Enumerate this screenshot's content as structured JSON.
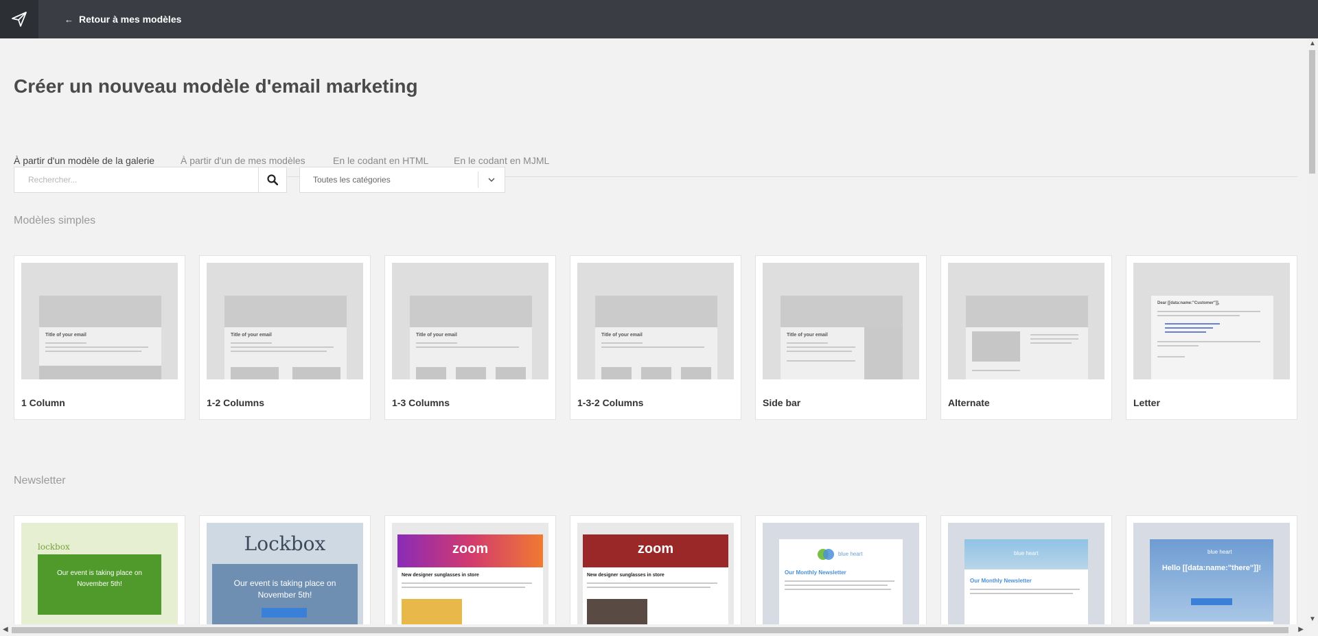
{
  "header": {
    "back_label": "Retour à mes modèles"
  },
  "page": {
    "title": "Créer un nouveau modèle d'email marketing"
  },
  "tabs": [
    {
      "label": "À partir d'un modèle de la galerie",
      "active": true
    },
    {
      "label": "À partir d'un de mes modèles",
      "active": false
    },
    {
      "label": "En le codant en HTML",
      "active": false
    },
    {
      "label": "En le codant en MJML",
      "active": false
    }
  ],
  "search": {
    "placeholder": "Rechercher..."
  },
  "category_filter": {
    "value": "Toutes les catégories"
  },
  "sections": {
    "simple": {
      "title": "Modèles simples",
      "templates": [
        {
          "label": "1 Column",
          "preview_title": "Title of your email"
        },
        {
          "label": "1-2 Columns",
          "preview_title": "Title of your email"
        },
        {
          "label": "1-3 Columns",
          "preview_title": "Title of your email"
        },
        {
          "label": "1-3-2 Columns",
          "preview_title": "Title of your email"
        },
        {
          "label": "Side bar",
          "preview_title": "Title of your email"
        },
        {
          "label": "Alternate",
          "preview_title": ""
        },
        {
          "label": "Letter",
          "preview_title": "Dear [[data:name:\"Customer\"]],"
        }
      ]
    },
    "newsletter": {
      "title": "Newsletter",
      "templates": [
        {
          "brand": "lockbox",
          "headline": "Our event is taking place on November 5th!"
        },
        {
          "brand": "Lockbox",
          "headline": "Our event is taking place on November 5th!"
        },
        {
          "brand": "zoom",
          "headline": "New designer sunglasses in store"
        },
        {
          "brand": "zoom",
          "headline": "New designer sunglasses in store"
        },
        {
          "brand": "blue heart",
          "headline": "Our Monthly Newsletter"
        },
        {
          "brand": "blue heart",
          "headline": "Our Monthly Newsletter"
        },
        {
          "brand": "blue heart",
          "headline": "Hello [[data:name:\"there\"]]!"
        }
      ]
    }
  },
  "colors": {
    "topbar": "#3a3e44",
    "logo_bg": "#2c2f34",
    "page_bg": "#f2f2f2"
  },
  "icons": {
    "logo": "paper-plane-icon",
    "back": "arrow-left-icon",
    "search": "magnifier-icon",
    "dropdown": "chevron-down-icon"
  }
}
